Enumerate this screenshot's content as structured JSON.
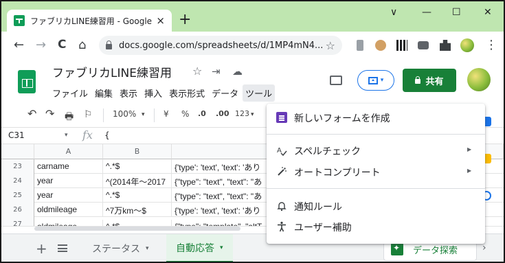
{
  "browser": {
    "tab_title": "ファブリカLINE練習用 - Google スプ",
    "tab_close": "×",
    "new_tab": "+",
    "window_controls": {
      "minimize": "∨",
      "restore": "—",
      "maximize": "☐",
      "close": "✕"
    },
    "nav": {
      "back": "←",
      "forward": "→",
      "reload": "C",
      "home": "⌂"
    },
    "url": "docs.google.com/spreadsheets/d/1MP4mN4...",
    "star": "☆",
    "more": "⋮"
  },
  "doc": {
    "title": "ファブリカLINE練習用",
    "title_icons": {
      "star": "☆",
      "move": "⇥",
      "cloud": "☁"
    },
    "menu": [
      "ファイル",
      "編集",
      "表示",
      "挿入",
      "表示形式",
      "データ",
      "ツール"
    ],
    "active_menu_index": 6,
    "share_label": "共有"
  },
  "toolbar": {
    "undo": "↶",
    "redo": "↷",
    "print": "🖶",
    "paint": "⚐",
    "zoom": "100%",
    "zoom_caret": "▾",
    "currency": "¥",
    "percent": "%",
    "dec_decrease": ".0",
    "dec_increase": ".00",
    "format_more": "123",
    "format_caret": "▾"
  },
  "formula": {
    "name_box": "C31",
    "name_caret": "▾",
    "fx": "fx",
    "value": "{"
  },
  "grid": {
    "columns": [
      "A",
      "B"
    ],
    "rows": [
      {
        "num": "23",
        "a": "carname",
        "b": "^.*$",
        "c": "{'type': 'text', 'text': 'あり"
      },
      {
        "num": "24",
        "a": "year",
        "b": "^(2014年～2017",
        "c": "{\"type\": \"text\", \"text\": \"あ"
      },
      {
        "num": "25",
        "a": "year",
        "b": "^.*$",
        "c": "{\"type\": \"text\", \"text\": \"あ"
      },
      {
        "num": "26",
        "a": "oldmileage",
        "b": "^7万km～$",
        "c": "{'type': 'text', 'text': 'あり"
      },
      {
        "num": "27",
        "a": "oldmileage",
        "b": "^.*$",
        "c": "{\"type\": \"template\", \"altT"
      }
    ]
  },
  "sheets": {
    "add": "+",
    "tabs": [
      {
        "label": "ステータス",
        "active": false
      },
      {
        "label": "自動応答",
        "active": true
      }
    ],
    "tab_caret": "▾",
    "explore_label": "データ探索",
    "scroll_right": "›"
  },
  "tools_menu": {
    "items": [
      {
        "label": "新しいフォームを作成",
        "icon": "form-icon",
        "submenu": false
      },
      {
        "label": "スペルチェック",
        "icon": "spellcheck-icon",
        "submenu": true
      },
      {
        "label": "オートコンプリート",
        "icon": "autocomplete-icon",
        "submenu": true
      },
      {
        "label": "通知ルール",
        "icon": "bell-icon",
        "submenu": false
      },
      {
        "label": "ユーザー補助",
        "icon": "accessibility-icon",
        "submenu": false
      }
    ],
    "submenu_arrow": "▶"
  },
  "colors": {
    "tab_strip": "#bfe6b0",
    "sheets_green": "#0f9d58",
    "share_green": "#188038",
    "form_purple": "#673ab7",
    "present_blue": "#1a73e8"
  }
}
